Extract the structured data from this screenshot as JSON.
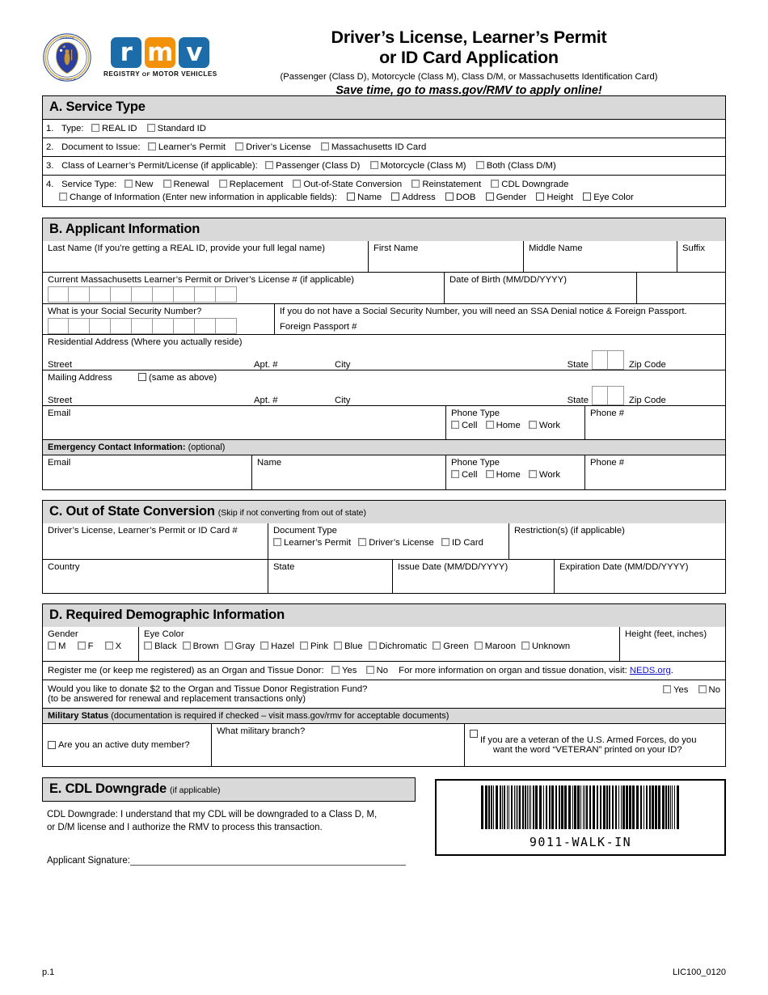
{
  "header": {
    "title_line1": "Driver’s License, Learner’s Permit",
    "title_line2": "or ID Card Application",
    "subtitle": "(Passenger (Class D), Motorcycle (Class M), Class D/M, or Massachusetts Identification Card)",
    "tagline": "Save time, go to mass.gov/RMV to apply online!",
    "logo": {
      "letters": [
        "r",
        "m",
        "v"
      ],
      "caption_1": "REGISTRY ",
      "caption_of": "OF",
      "caption_2": " MOTOR VEHICLES",
      "blue": "#1b6ca8",
      "orange": "#f2920a"
    }
  },
  "section_a": {
    "heading": "A. Service Type",
    "row1": {
      "num": "1.",
      "label": "Type:",
      "options": [
        "REAL ID",
        "Standard ID"
      ]
    },
    "row2": {
      "num": "2.",
      "label": "Document to Issue:",
      "options": [
        "Learner’s Permit",
        "Driver’s License",
        "Massachusetts ID Card"
      ]
    },
    "row3": {
      "num": "3.",
      "label": "Class of Learner’s Permit/License (if applicable):",
      "options": [
        "Passenger (Class D)",
        "Motorcycle (Class M)",
        "Both (Class D/M)"
      ]
    },
    "row4": {
      "num": "4.",
      "label": "Service Type:",
      "options": [
        "New",
        "Renewal",
        "Replacement",
        "Out-of-State Conversion",
        "Reinstatement",
        "CDL Downgrade"
      ],
      "change_label": "Change of Information (Enter new information in applicable fields):",
      "change_options": [
        "Name",
        "Address",
        "DOB",
        "Gender",
        "Height",
        "Eye Color"
      ]
    }
  },
  "section_b": {
    "heading": "B. Applicant Information",
    "last_name": "Last Name (If you’re getting a REAL ID, provide your full legal name)",
    "first_name": "First Name",
    "middle_name": "Middle Name",
    "suffix": "Suffix",
    "license_num": "Current Massachusetts Learner’s Permit or Driver’s License # (if applicable)",
    "license_boxes": 9,
    "dob": "Date of Birth (MM/DD/YYYY)",
    "ssn": "What is your Social Security Number?",
    "ssn_boxes": 9,
    "ssn_note": "If you do not have a Social Security Number, you will need an SSA Denial notice & Foreign Passport.",
    "passport": "Foreign Passport #",
    "residential": "Residential Address (Where you actually reside)",
    "street": "Street",
    "apt": "Apt. #",
    "city": "City",
    "state": "State",
    "zip": "Zip Code",
    "mailing": "Mailing Address",
    "same_as_above": "(same as above)",
    "email": "Email",
    "phone_type": "Phone Type",
    "phone_type_options": [
      "Cell",
      "Home",
      "Work"
    ],
    "phone_num": "Phone #",
    "emergency_heading_bold": "Emergency Contact Information:",
    "emergency_heading_rest": " (optional)",
    "name": "Name"
  },
  "section_c": {
    "heading": "C. Out of State Conversion",
    "heading_note": "(Skip if not converting from out of state)",
    "doc_num": "Driver’s License, Learner’s Permit or ID Card #",
    "doc_type": "Document Type",
    "doc_type_options": [
      "Learner’s Permit",
      "Driver’s License",
      "ID Card"
    ],
    "restrictions": "Restriction(s) (if applicable)",
    "country": "Country",
    "state": "State",
    "issue_date": "Issue Date (MM/DD/YYYY)",
    "expiration_date": "Expiration Date (MM/DD/YYYY)"
  },
  "section_d": {
    "heading": "D. Required Demographic Information",
    "gender": "Gender",
    "gender_options": [
      "M",
      "F",
      "X"
    ],
    "eye_color": "Eye Color",
    "eye_color_options": [
      "Black",
      "Brown",
      "Gray",
      "Hazel",
      "Pink",
      "Blue",
      "Dichromatic",
      "Green",
      "Maroon",
      "Unknown"
    ],
    "height": "Height (feet, inches)",
    "organ_label": "Register me (or keep me registered) as an Organ and Tissue Donor:",
    "organ_options": [
      "Yes",
      "No"
    ],
    "organ_info_pre": "For more information on organ and tissue donation, visit: ",
    "organ_link": "NEDS.org",
    "organ_info_post": ".",
    "donate_line1": "Would you like to donate $2 to the Organ and Tissue Donor Registration Fund?",
    "donate_line2": "(to be answered for renewal and replacement transactions only)",
    "donate_options": [
      "Yes",
      "No"
    ],
    "military_bold": "Military Status",
    "military_rest": " (documentation is required if checked – visit mass.gov/rmv for acceptable documents)",
    "active_duty": "Are you an active duty member?",
    "branch": "What military branch?",
    "veteran_line1": "If you are a veteran of the U.S. Armed Forces, do you",
    "veteran_line2": "want the word “VETERAN” printed on your ID?"
  },
  "section_e": {
    "heading": "E. CDL Downgrade",
    "heading_note": "(if applicable)",
    "body_line1": "CDL Downgrade: I understand that my CDL will be downgraded to a Class D, M,",
    "body_line2": "or D/M license and I authorize the RMV to process this transaction.",
    "signature": "Applicant Signature:"
  },
  "barcode": {
    "value": "9011-WALK-IN"
  },
  "footer": {
    "page": "p.1",
    "form_id": "LIC100_0120"
  }
}
